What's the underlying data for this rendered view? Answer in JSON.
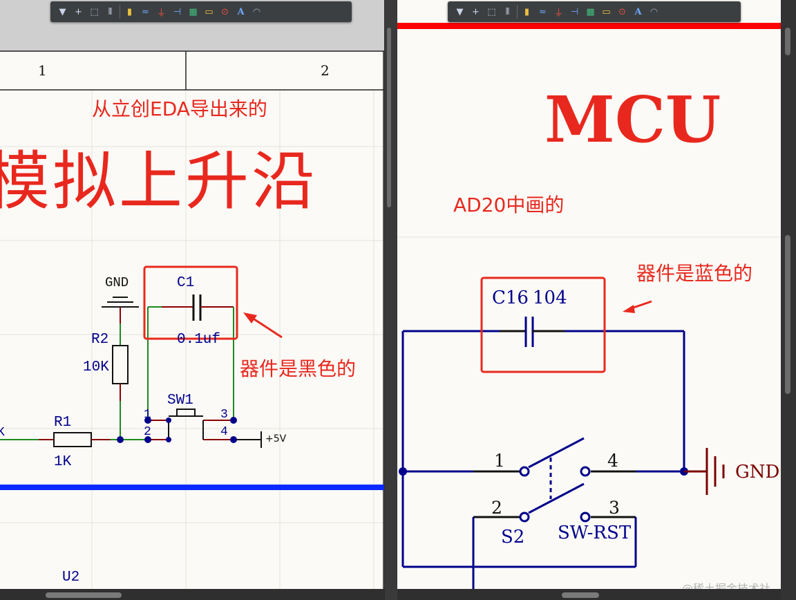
{
  "toolbar_left": {
    "buttons": [
      "filter-icon",
      "add-icon",
      "select-rect-icon",
      "align-icon",
      "component-icon",
      "bus-icon",
      "ground-icon",
      "net-label-icon",
      "harness-icon",
      "port-icon",
      "power-port-icon",
      "text-icon",
      "arc-icon"
    ],
    "text_glyph": "A"
  },
  "toolbar_right": {
    "buttons": [
      "filter-icon",
      "add-icon",
      "select-rect-icon",
      "align-icon",
      "component-icon",
      "bus-icon",
      "ground-icon",
      "net-label-icon",
      "harness-icon",
      "port-icon",
      "power-port-icon",
      "text-icon",
      "arc-icon"
    ],
    "text_glyph": "A"
  },
  "left_sheet": {
    "zone_labels": [
      "1",
      "2"
    ],
    "annotation_top": "从立创EDA导出来的",
    "big_title": "模拟上升沿",
    "annotation_side": "器件是黑色的",
    "components": {
      "gnd_label": "GND",
      "c1_designator": "C1",
      "c1_value": "0.1uf",
      "r2_designator": "R2",
      "r2_value": "10K",
      "sw1_designator": "SW1",
      "r1_designator": "R1",
      "r1_value": "1K",
      "pin1": "1",
      "pin2": "2",
      "pin3": "3",
      "pin4": "4",
      "vcc_label": "+5V",
      "left_edge_letter": "K",
      "u2_designator": "U2"
    },
    "colors": {
      "wire": "#1e8a1e",
      "pin": "#8b0000",
      "junction": "#00008b",
      "bus": "#0a2aff",
      "annotation": "#e8281e"
    }
  },
  "right_sheet": {
    "big_title": "MCU",
    "annotation_top": "AD20中画的",
    "annotation_side": "器件是蓝色的",
    "components": {
      "cap_designator": "C16",
      "cap_value": "104",
      "pin1": "1",
      "pin2": "2",
      "pin3": "3",
      "pin4": "4",
      "sw_designator": "S2",
      "sw_value": "SW-RST",
      "gnd_label": "GND"
    },
    "colors": {
      "wire": "#00008b",
      "gnd": "#7a0000",
      "annotation": "#e8281e",
      "header_line": "#ff0000"
    }
  },
  "watermark": "@稀土掘金技术社区"
}
